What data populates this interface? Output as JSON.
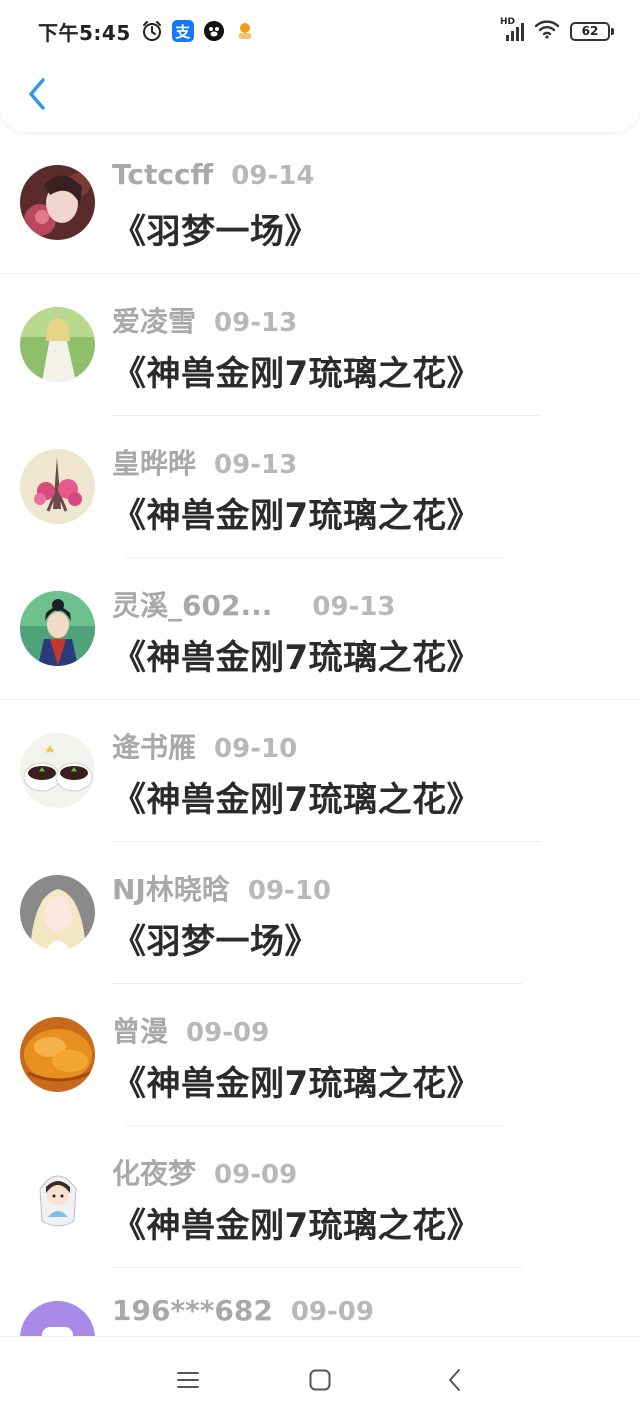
{
  "status_bar": {
    "time": "下午5:45",
    "alipay_glyph": "支",
    "network": "HD",
    "battery": "62"
  },
  "header": {
    "back_icon": "chevron-left-icon",
    "accent_color": "#2b9ae8"
  },
  "list": {
    "items": [
      {
        "user": "Tctccff",
        "date": "09-14",
        "title": "《羽梦一场》",
        "avatar": "avatar-girl-roses"
      },
      {
        "user": "爱凌雪",
        "date": "09-13",
        "title": "《神兽金刚7琉璃之花》",
        "avatar": "avatar-doll-white-dress"
      },
      {
        "user": "皇晔晔",
        "date": "09-13",
        "title": "《神兽金刚7琉璃之花》",
        "avatar": "avatar-pink-eiffel-tower"
      },
      {
        "user": "灵溪_602...",
        "date": "09-13",
        "title": "《神兽金刚7琉璃之花》",
        "avatar": "avatar-costume-girl"
      },
      {
        "user": "逄书雁",
        "date": "09-10",
        "title": "《神兽金刚7琉璃之花》",
        "avatar": "avatar-dessert-cups"
      },
      {
        "user": "NJ林晓晗",
        "date": "09-10",
        "title": "《羽梦一场》",
        "avatar": "avatar-blonde-girl"
      },
      {
        "user": "曾漫",
        "date": "09-09",
        "title": "《神兽金刚7琉璃之花》",
        "avatar": "avatar-pastry"
      },
      {
        "user": "化夜梦",
        "date": "09-09",
        "title": "《神兽金刚7琉璃之花》",
        "avatar": "avatar-cartoon-girl"
      },
      {
        "user": "196***682",
        "date": "09-09",
        "title": "",
        "avatar": "avatar-purple-default"
      }
    ]
  },
  "navbar": {
    "menu_icon": "menu-icon",
    "home_icon": "home-square-icon",
    "back_icon": "back-triangle-icon"
  }
}
